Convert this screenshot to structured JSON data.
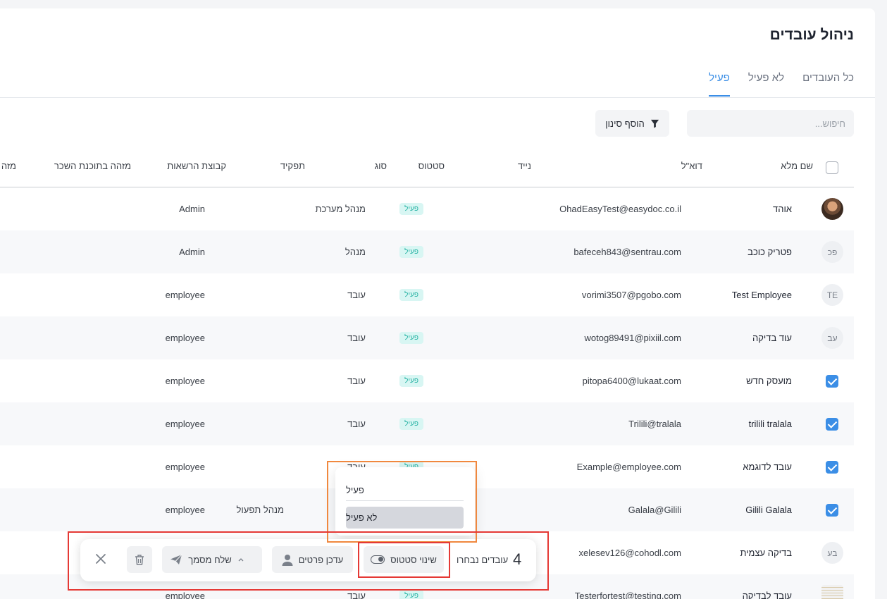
{
  "page": {
    "title": "ניהול עובדים",
    "tabs": [
      {
        "label": "פעיל",
        "active": true
      },
      {
        "label": "לא פעיל",
        "active": false
      },
      {
        "label": "כל העובדים",
        "active": false
      }
    ],
    "search_placeholder": "חיפוש...",
    "filter_label": "הוסף סינון",
    "accent_color": "#3b8ee6"
  },
  "table": {
    "headers": {
      "name": "שם מלא",
      "email": "דוא\"ל",
      "mobile": "נייד",
      "status": "סטטוס",
      "type": "סוג",
      "role": "תפקיד",
      "permissions": "קבוצת הרשאות",
      "payroll_id": "מזהה בתוכנת השכר",
      "cut_column": "מזה"
    },
    "rows": [
      {
        "avatar": "photo",
        "initials": "",
        "name": "אוהד",
        "email": "OhadEasyTest@easydoc.co.il",
        "status": "פעיל",
        "type": "מנהל מערכת",
        "role": "",
        "permissions": "Admin",
        "checked": false
      },
      {
        "avatar": "initials",
        "initials": "פכ",
        "name": "פטריק כוכב",
        "email": "bafeceh843@sentrau.com",
        "status": "פעיל",
        "type": "מנהל",
        "role": "",
        "permissions": "Admin",
        "checked": false
      },
      {
        "avatar": "initials",
        "initials": "TE",
        "name": "Test Employee",
        "email": "vorimi3507@pgobo.com",
        "status": "פעיל",
        "type": "עובד",
        "role": "",
        "permissions": "employee",
        "checked": false
      },
      {
        "avatar": "initials",
        "initials": "עב",
        "name": "עוד בדיקה",
        "email": "wotog89491@pixiil.com",
        "status": "פעיל",
        "type": "עובד",
        "role": "",
        "permissions": "employee",
        "checked": false
      },
      {
        "avatar": "checkbox",
        "initials": "",
        "name": "מועסק חדש",
        "email": "pitopa6400@lukaat.com",
        "status": "פעיל",
        "type": "עובד",
        "role": "",
        "permissions": "employee",
        "checked": true
      },
      {
        "avatar": "checkbox",
        "initials": "",
        "name": "trilili tralala",
        "email": "Trilili@tralala",
        "status": "פעיל",
        "type": "עובד",
        "role": "",
        "permissions": "employee",
        "checked": true
      },
      {
        "avatar": "checkbox",
        "initials": "",
        "name": "עובד לדוגמא",
        "email": "Example@employee.com",
        "status": "פעיל",
        "type": "עובד",
        "role": "",
        "permissions": "employee",
        "checked": true
      },
      {
        "avatar": "checkbox",
        "initials": "",
        "name": "Gilili Galala",
        "email": "Galala@Gilili",
        "status": "",
        "type": "",
        "role": "מנהל תפעול",
        "permissions": "employee",
        "checked": true
      },
      {
        "avatar": "initials",
        "initials": "בע",
        "name": "בדיקה עצמית",
        "email": "xelesev126@cohodl.com",
        "status": "",
        "type": "",
        "role": "",
        "permissions": "",
        "checked": false
      },
      {
        "avatar": "doc",
        "initials": "",
        "name": "עובד לבדיקה",
        "email": "Testerfortest@testing.com",
        "status": "פעיל",
        "type": "עובד",
        "role": "",
        "permissions": "employee",
        "checked": false
      }
    ]
  },
  "status_dropdown": {
    "options": [
      "פעיל",
      "לא פעיל"
    ],
    "highlighted": "לא פעיל"
  },
  "action_bar": {
    "selected_count": "4",
    "selected_label": "עובדים נבחרו",
    "change_status": "שינוי סטטוס",
    "update_details": "עדכן פרטים",
    "send_document": "שלח מסמך"
  },
  "status_badge_color": "#25b2a3",
  "highlight_colors": {
    "orange": "#f0883e",
    "red": "#e53935"
  }
}
